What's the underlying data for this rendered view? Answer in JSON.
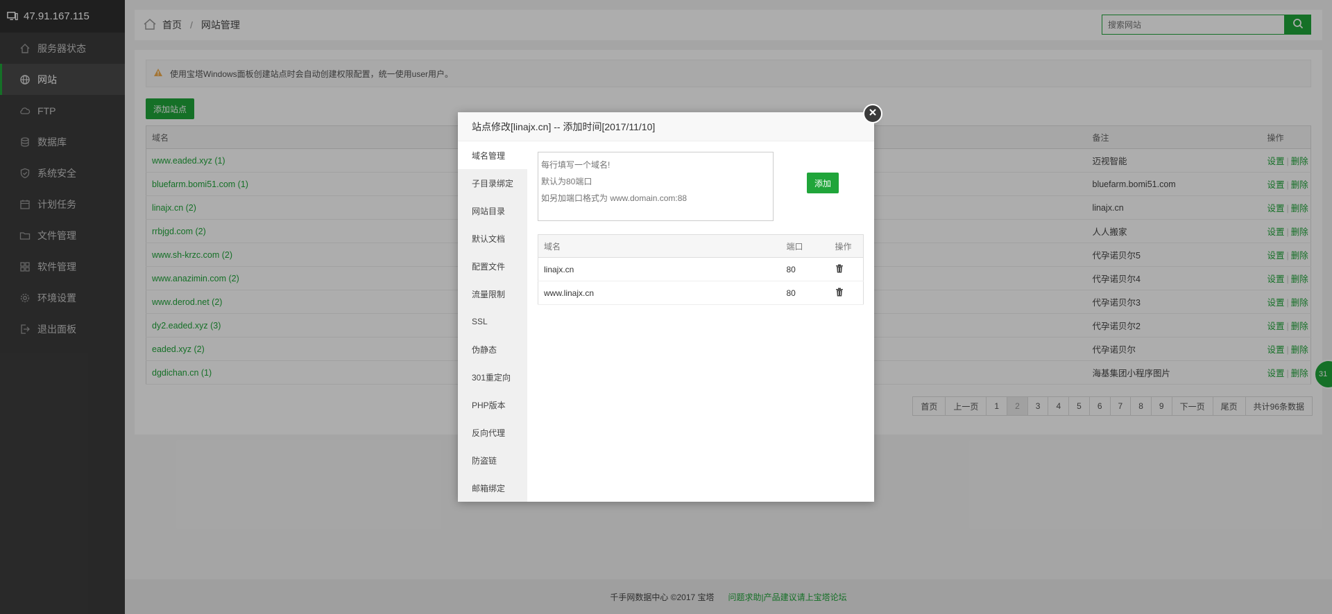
{
  "sidebar": {
    "server_ip": "47.91.167.115",
    "items": [
      {
        "label": "服务器状态",
        "icon": "home-icon"
      },
      {
        "label": "网站",
        "icon": "globe-icon"
      },
      {
        "label": "FTP",
        "icon": "cloud-icon"
      },
      {
        "label": "数据库",
        "icon": "database-icon"
      },
      {
        "label": "系统安全",
        "icon": "shield-icon"
      },
      {
        "label": "计划任务",
        "icon": "calendar-icon"
      },
      {
        "label": "文件管理",
        "icon": "folder-icon"
      },
      {
        "label": "软件管理",
        "icon": "grid-icon"
      },
      {
        "label": "环境设置",
        "icon": "gear-icon"
      },
      {
        "label": "退出面板",
        "icon": "logout-icon"
      }
    ],
    "active_index": 1
  },
  "topbar": {
    "breadcrumb_home": "首页",
    "breadcrumb_sep": "/",
    "breadcrumb_current": "网站管理",
    "search_placeholder": "搜索网站"
  },
  "notice": "使用宝塔Windows面板创建站点时会自动创建权限配置，统一使用user用户。",
  "add_site_label": "添加站点",
  "table": {
    "headers": {
      "domain": "域名",
      "note": "备注",
      "ops": "操作"
    },
    "op_settings": "设置",
    "op_sep": "|",
    "op_delete": "删除",
    "rows": [
      {
        "domain": "www.eaded.xyz (1)",
        "note": "迈视智能"
      },
      {
        "domain": "bluefarm.bomi51.com (1)",
        "note": "bluefarm.bomi51.com"
      },
      {
        "domain": "linajx.cn (2)",
        "note": "linajx.cn"
      },
      {
        "domain": "rrbjgd.com (2)",
        "note": "人人搬家"
      },
      {
        "domain": "www.sh-krzc.com (2)",
        "note": "代孕诺贝尔5"
      },
      {
        "domain": "www.anazimin.com (2)",
        "note": "代孕诺贝尔4"
      },
      {
        "domain": "www.derod.net (2)",
        "note": "代孕诺贝尔3"
      },
      {
        "domain": "dy2.eaded.xyz (3)",
        "note": "代孕诺贝尔2"
      },
      {
        "domain": "eaded.xyz (2)",
        "note": "代孕诺贝尔"
      },
      {
        "domain": "dgdichan.cn (1)",
        "note": "海基集团小程序图片"
      }
    ]
  },
  "pager": {
    "first": "首页",
    "prev": "上一页",
    "pages": [
      "1",
      "2",
      "3",
      "4",
      "5",
      "6",
      "7",
      "8",
      "9"
    ],
    "current": "2",
    "next": "下一页",
    "last": "尾页",
    "total": "共计96条数据"
  },
  "footer": {
    "copyright": "千手网数据中心 ©2017 宝塔",
    "link": "问题求助|产品建议请上宝塔论坛"
  },
  "float_ball_text": "31",
  "modal": {
    "title": "站点修改[linajx.cn] -- 添加时间[2017/11/10]",
    "tabs": [
      "域名管理",
      "子目录绑定",
      "网站目录",
      "默认文档",
      "配置文件",
      "流量限制",
      "SSL",
      "伪静态",
      "301重定向",
      "PHP版本",
      "反向代理",
      "防盗链",
      "邮箱绑定"
    ],
    "active_tab": 0,
    "textarea_placeholder": "每行填写一个域名!\n默认为80端口\n如另加端口格式为 www.domain.com:88",
    "add_label": "添加",
    "domain_table": {
      "headers": {
        "domain": "域名",
        "port": "端口",
        "ops": "操作"
      },
      "rows": [
        {
          "domain": "linajx.cn",
          "port": "80"
        },
        {
          "domain": "www.linajx.cn",
          "port": "80"
        }
      ]
    }
  },
  "colors": {
    "accent": "#20a53a",
    "sidebar_bg": "#3c3c3c"
  }
}
